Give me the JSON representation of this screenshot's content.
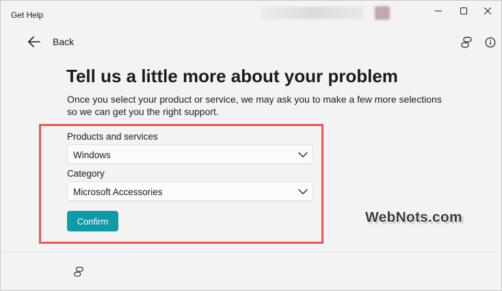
{
  "window": {
    "title": "Get Help"
  },
  "nav": {
    "back_label": "Back"
  },
  "page": {
    "heading": "Tell us a little more about your problem",
    "subtitle": "Once you select your product or service, we may ask you to make a few more selections so we can get you the right support."
  },
  "form": {
    "product_label": "Products and services",
    "product_value": "Windows",
    "category_label": "Category",
    "category_value": "Microsoft Accessories",
    "confirm_label": "Confirm"
  },
  "watermark": {
    "text": "WebNots.com"
  },
  "icons": {
    "back": "arrow-left-icon",
    "chat": "chat-bubbles-icon",
    "info": "info-icon",
    "dropdown": "chevron-down-icon"
  },
  "colors": {
    "accent": "#0f9aa8",
    "highlight_border": "#e05a50",
    "background": "#f3f3f3"
  }
}
